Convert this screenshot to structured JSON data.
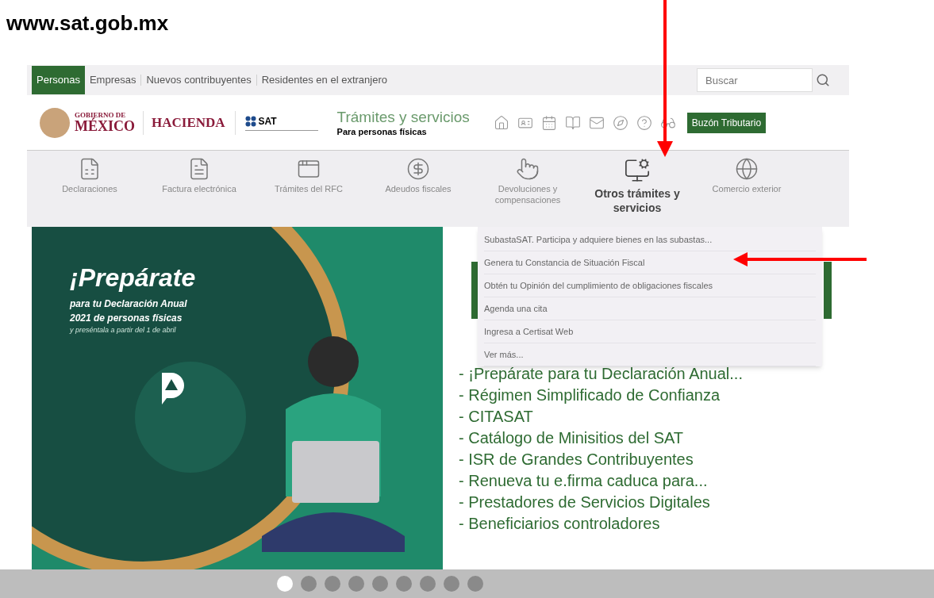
{
  "annotation": {
    "title": "www.sat.gob.mx"
  },
  "top_bar": {
    "tabs": [
      {
        "label": "Personas",
        "selected": true
      },
      {
        "label": "Empresas",
        "selected": false
      },
      {
        "label": "Nuevos contribuyentes",
        "selected": false
      },
      {
        "label": "Residentes en el extranjero",
        "selected": false
      }
    ],
    "search": {
      "placeholder": "Buscar"
    }
  },
  "header": {
    "gobierno_line1": "GOBIERNO DE",
    "gobierno_line2": "MÉXICO",
    "hacienda": "HACIENDA",
    "sat": "SAT",
    "section_title": "Trámites y servicios",
    "section_subtitle": "Para personas físicas",
    "button": "Buzón Tributario"
  },
  "nav": [
    {
      "label": "Declaraciones",
      "selected": false
    },
    {
      "label": "Factura electrónica",
      "selected": false
    },
    {
      "label": "Trámites del RFC",
      "selected": false
    },
    {
      "label": "Adeudos fiscales",
      "selected": false
    },
    {
      "label": "Devoluciones y compensaciones",
      "selected": false
    },
    {
      "label": "Otros trámites y servicios",
      "selected": true
    },
    {
      "label": "Comercio exterior",
      "selected": false
    }
  ],
  "dropdown": {
    "items": [
      "SubastaSAT. Participa y adquiere bienes en las subastas...",
      "Genera tu Constancia de Situación Fiscal",
      "Obtén tu Opinión del cumplimiento de obligaciones fiscales",
      "Agenda una cita",
      "Ingresa a Certisat Web",
      "Ver más..."
    ]
  },
  "banner": {
    "headline": "¡Prepárate",
    "lines": [
      "para tu Declaración Anual",
      "2021 de personas físicas",
      "y preséntala a partir del 1 de abril"
    ]
  },
  "news": [
    "- ¡Prepárate para tu Declaración Anual...",
    "- Régimen Simplificado de Confianza",
    "- CITASAT",
    "- Catálogo de Minisitios del SAT",
    "- ISR de Grandes Contribuyentes",
    "- Renueva tu e.firma caduca para...",
    "- Prestadores de Servicios Digitales",
    "- Beneficiarios controladores"
  ],
  "carousel": {
    "dots": [
      {
        "selected": true
      },
      {
        "selected": false
      },
      {
        "selected": false
      },
      {
        "selected": false
      },
      {
        "selected": false
      },
      {
        "selected": false
      },
      {
        "selected": false
      },
      {
        "selected": false
      },
      {
        "selected": false
      }
    ]
  }
}
